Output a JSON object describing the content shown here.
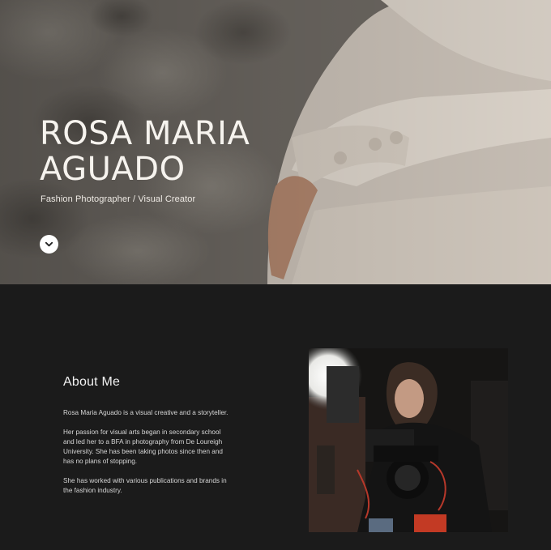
{
  "hero": {
    "title_line1": "ROSA MARIA",
    "title_line2": "AGUADO",
    "subtitle": "Fashion Photographer / Visual Creator",
    "scroll_icon": "chevron-down-icon"
  },
  "about": {
    "heading": "About Me",
    "paragraphs": [
      "Rosa Maria Aguado is a visual creative and a storyteller.",
      "Her passion for visual arts began in secondary school and led her to a BFA in photography from De Loureigh University. She has been taking photos since then and has no plans of stopping.",
      "She has worked with various publications and brands in the fashion industry."
    ]
  },
  "colors": {
    "page_background": "#1b1b1b",
    "hero_text": "#f6f3ee",
    "body_text": "#d6d6d6"
  }
}
